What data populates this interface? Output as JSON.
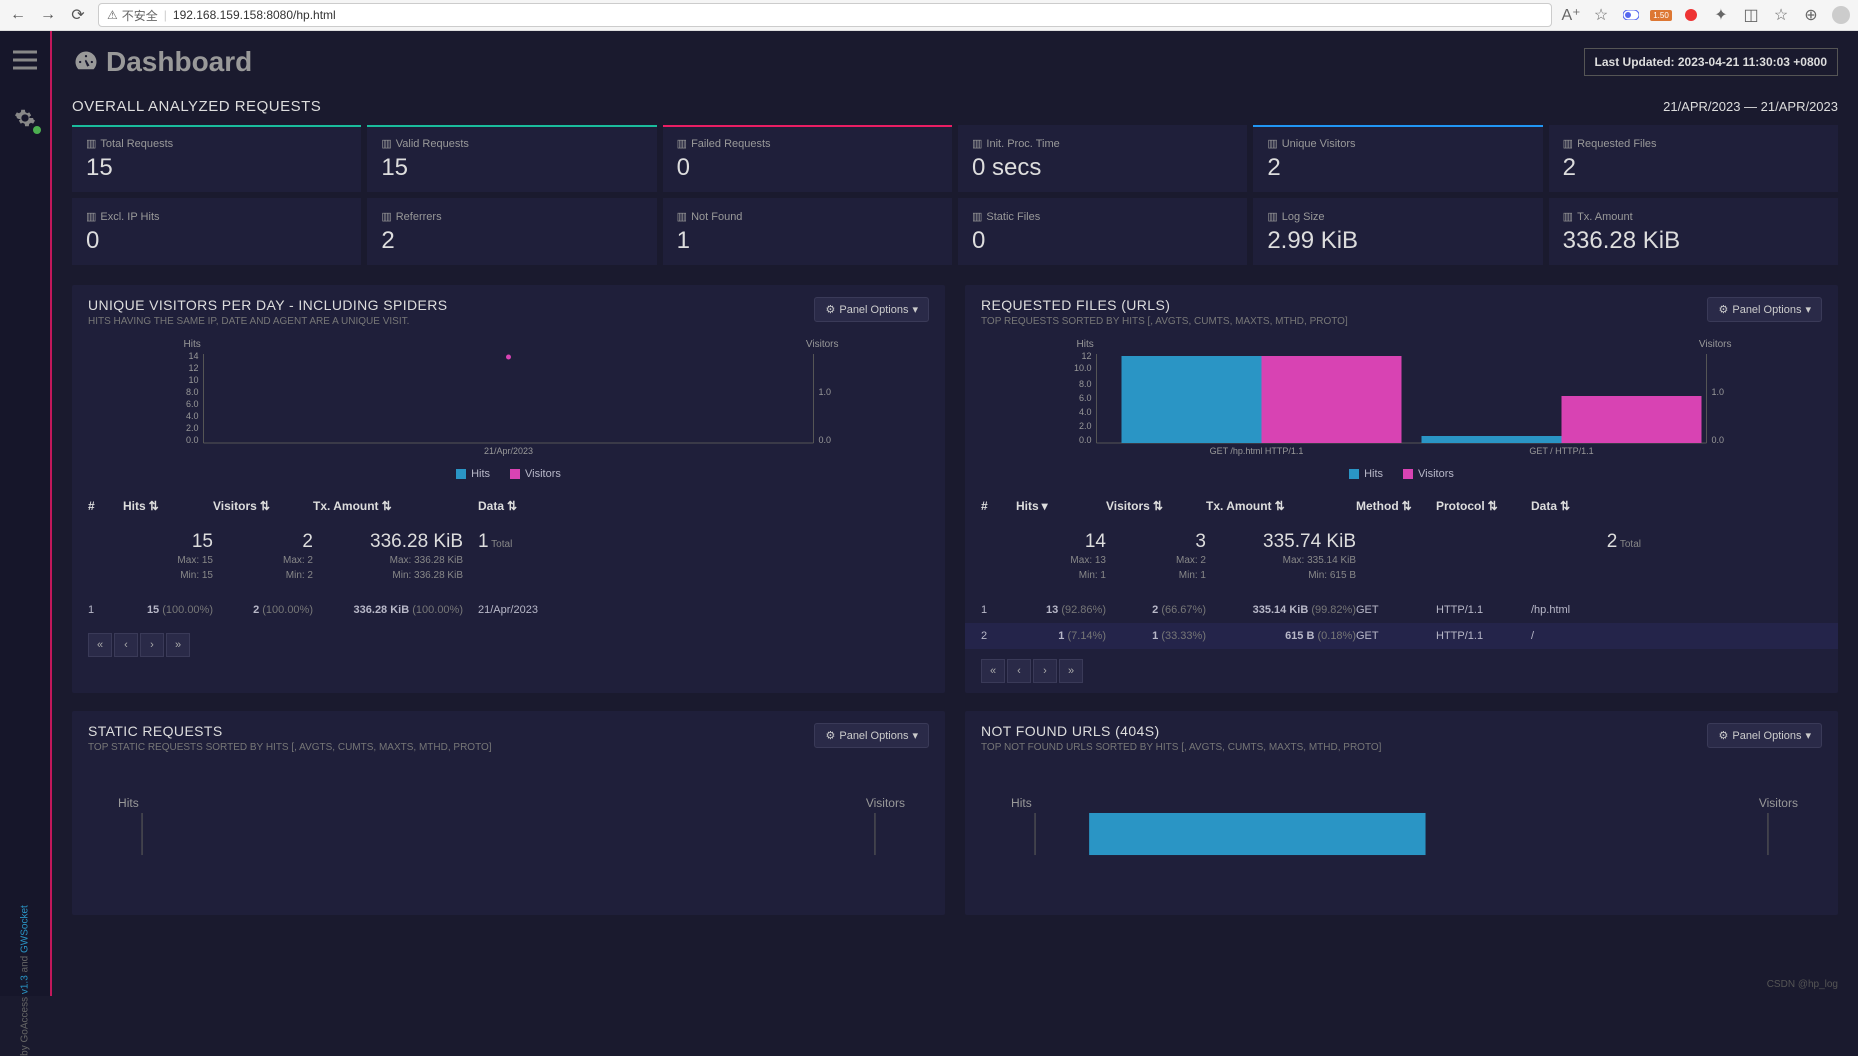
{
  "browser": {
    "insecure_label": "不安全",
    "url": "192.168.159.158:8080/hp.html",
    "ext_badge": "1.50"
  },
  "sidebar_credit": {
    "prefix": "by GoAccess ",
    "v": "v1.3",
    "mid": " and ",
    "gw": "GWSocket"
  },
  "header": {
    "title": "Dashboard",
    "last_updated": "Last Updated: 2023-04-21 11:30:03 +0800"
  },
  "overall": {
    "title": "OVERALL ANALYZED REQUESTS",
    "date_range": "21/APR/2023 — 21/APR/2023",
    "stats": [
      {
        "label": "Total Requests",
        "value": "15",
        "cls": "teal"
      },
      {
        "label": "Valid Requests",
        "value": "15",
        "cls": "teal"
      },
      {
        "label": "Failed Requests",
        "value": "0",
        "cls": "pink"
      },
      {
        "label": "Init. Proc. Time",
        "value": "0 secs",
        "cls": ""
      },
      {
        "label": "Unique Visitors",
        "value": "2",
        "cls": "blue"
      },
      {
        "label": "Requested Files",
        "value": "2",
        "cls": ""
      },
      {
        "label": "Excl. IP Hits",
        "value": "0",
        "cls": ""
      },
      {
        "label": "Referrers",
        "value": "2",
        "cls": ""
      },
      {
        "label": "Not Found",
        "value": "1",
        "cls": ""
      },
      {
        "label": "Static Files",
        "value": "0",
        "cls": ""
      },
      {
        "label": "Log Size",
        "value": "2.99 KiB",
        "cls": ""
      },
      {
        "label": "Tx. Amount",
        "value": "336.28 KiB",
        "cls": ""
      }
    ]
  },
  "panel_opts": "Panel Options",
  "legend": {
    "hits": "Hits",
    "visitors": "Visitors"
  },
  "visitors_panel": {
    "title": "UNIQUE VISITORS PER DAY - INCLUDING SPIDERS",
    "sub": "HITS HAVING THE SAME IP, DATE AND AGENT ARE A UNIQUE VISIT.",
    "headers": {
      "n": "#",
      "hits": "Hits",
      "vis": "Visitors",
      "tx": "Tx. Amount",
      "data": "Data"
    },
    "summary": {
      "hits": "15",
      "hits_max": "Max: 15",
      "hits_min": "Min: 15",
      "vis": "2",
      "vis_max": "Max: 2",
      "vis_min": "Min: 2",
      "tx": "336.28 KiB",
      "tx_max": "Max: 336.28 KiB",
      "tx_min": "Min: 336.28 KiB",
      "total_n": "1",
      "total_lbl": " Total"
    },
    "rows": [
      {
        "n": "1",
        "hits": "15",
        "hits_p": " (100.00%)",
        "vis": "2",
        "vis_p": " (100.00%)",
        "tx": "336.28 KiB",
        "tx_p": " (100.00%)",
        "data": "21/Apr/2023"
      }
    ]
  },
  "files_panel": {
    "title": "REQUESTED FILES (URLS)",
    "sub": "TOP REQUESTS SORTED BY HITS [, AVGTS, CUMTS, MAXTS, MTHD, PROTO]",
    "headers": {
      "n": "#",
      "hits": "Hits",
      "vis": "Visitors",
      "tx": "Tx. Amount",
      "meth": "Method",
      "proto": "Protocol",
      "data": "Data"
    },
    "summary": {
      "hits": "14",
      "hits_max": "Max: 13",
      "hits_min": "Min: 1",
      "vis": "3",
      "vis_max": "Max: 2",
      "vis_min": "Min: 1",
      "tx": "335.74 KiB",
      "tx_max": "Max: 335.14 KiB",
      "tx_min": "Min: 615 B",
      "total_n": "2",
      "total_lbl": " Total"
    },
    "rows": [
      {
        "n": "1",
        "hits": "13",
        "hits_p": " (92.86%)",
        "vis": "2",
        "vis_p": " (66.67%)",
        "tx": "335.14 KiB",
        "tx_p": " (99.82%)",
        "meth": "GET",
        "proto": "HTTP/1.1",
        "data": "/hp.html"
      },
      {
        "n": "2",
        "hits": "1",
        "hits_p": " (7.14%)",
        "vis": "1",
        "vis_p": " (33.33%)",
        "tx": "615 B",
        "tx_p": " (0.18%)",
        "meth": "GET",
        "proto": "HTTP/1.1",
        "data": "/"
      }
    ]
  },
  "static_panel": {
    "title": "STATIC REQUESTS",
    "sub": "TOP STATIC REQUESTS SORTED BY HITS [, AVGTS, CUMTS, MAXTS, MTHD, PROTO]"
  },
  "notfound_panel": {
    "title": "NOT FOUND URLS (404S)",
    "sub": "TOP NOT FOUND URLS SORTED BY HITS [, AVGTS, CUMTS, MAXTS, MTHD, PROTO]"
  },
  "watermark": "CSDN @hp_log",
  "chart_data": [
    {
      "type": "scatter",
      "title": "Unique Visitors Per Day",
      "x": [
        "21/Apr/2023"
      ],
      "series": [
        {
          "name": "Hits",
          "values": [
            15
          ],
          "color": "#2a95c5"
        },
        {
          "name": "Visitors",
          "values": [
            2
          ],
          "color": "#d843b3"
        }
      ],
      "y_left_label": "Hits",
      "y_right_label": "Visitors",
      "y_left_ticks": [
        0.0,
        2.0,
        4.0,
        6.0,
        8.0,
        10.0,
        12.0,
        14.0
      ],
      "y_right_ticks": [
        0.0,
        1.0
      ]
    },
    {
      "type": "bar",
      "title": "Requested Files",
      "categories": [
        "GET /hp.html HTTP/1.1",
        "GET / HTTP/1.1"
      ],
      "series": [
        {
          "name": "Hits",
          "values": [
            13,
            1
          ],
          "color": "#2a95c5"
        },
        {
          "name": "Visitors",
          "values": [
            2,
            1
          ],
          "color": "#d843b3"
        }
      ],
      "y_left_label": "Hits",
      "y_right_label": "Visitors",
      "y_left_ticks": [
        0.0,
        2.0,
        4.0,
        6.0,
        8.0,
        10.0,
        12.0
      ],
      "y_right_ticks": [
        0.0,
        1.0
      ]
    }
  ]
}
